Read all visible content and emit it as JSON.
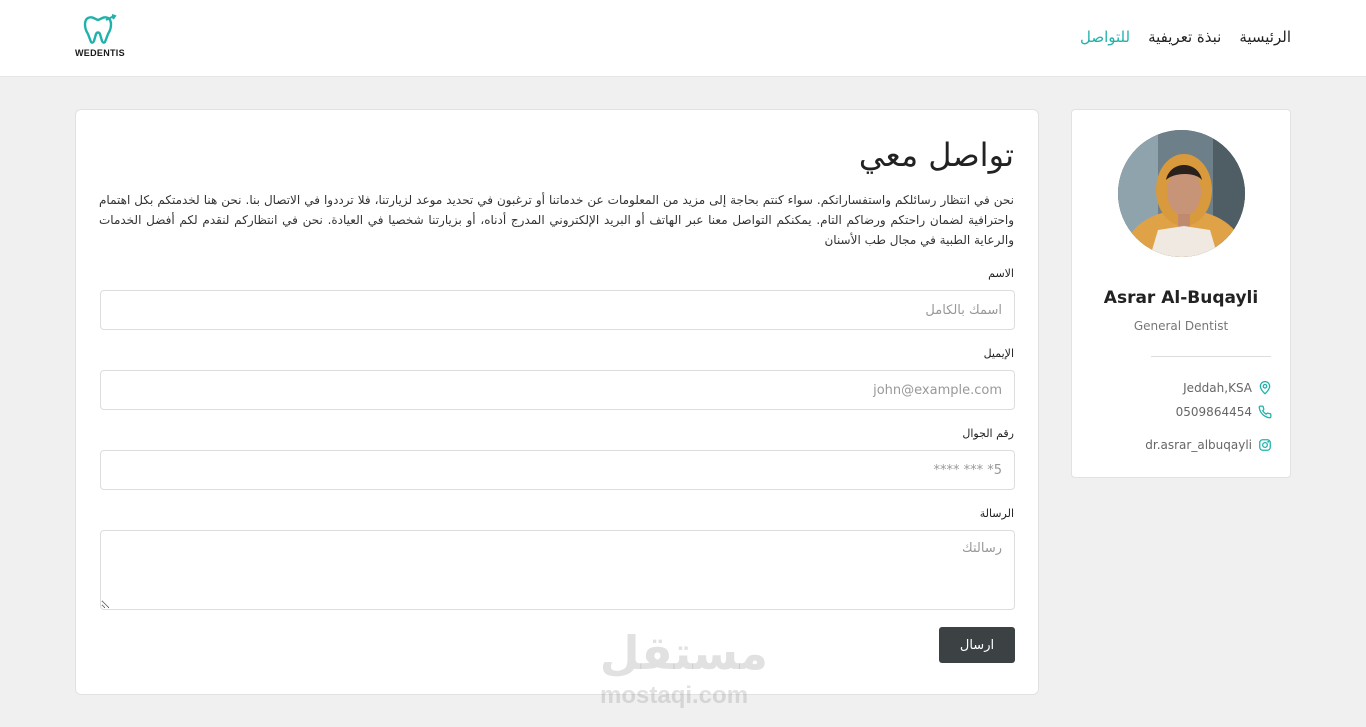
{
  "brand": {
    "name": "WEDENTIS",
    "accent": "#20b2aa"
  },
  "nav": {
    "items": [
      {
        "label": "الرئيسية"
      },
      {
        "label": "نبذة تعريفية"
      },
      {
        "label": "للتواصل"
      }
    ],
    "active_index": 2
  },
  "profile": {
    "name": "Asrar Al-Buqayli",
    "role": "General Dentist",
    "location": "Jeddah,KSA",
    "phone": "0509864454",
    "instagram": "dr.asrar_albuqayli"
  },
  "form": {
    "title": "تواصل معي",
    "intro": "نحن في انتظار رسائلكم واستفساراتكم. سواء كنتم بحاجة إلى مزيد من المعلومات عن خدماتنا أو ترغبون في تحديد موعد لزيارتنا، فلا ترددوا في الاتصال بنا. نحن هنا لخدمتكم بكل اهتمام واحترافية لضمان راحتكم ورضاكم التام. يمكنكم التواصل معنا عبر الهاتف أو البريد الإلكتروني المدرج أدناه، أو بزيارتنا شخصيا في العيادة. نحن في انتظاركم لنقدم لكم أفضل الخدمات والرعاية الطبية في مجال طب الأسنان",
    "name_label": "الاسم",
    "name_placeholder": "اسمك بالكامل",
    "email_label": "الإيميل",
    "email_placeholder": "john@example.com",
    "phone_label": "رقم الجوال",
    "phone_placeholder": "5* *** ****",
    "message_label": "الرسالة",
    "message_placeholder": "رسالتك",
    "submit_label": "ارسال"
  },
  "watermark": {
    "arabic": "مستقل",
    "latin": "mostaqi.com"
  }
}
